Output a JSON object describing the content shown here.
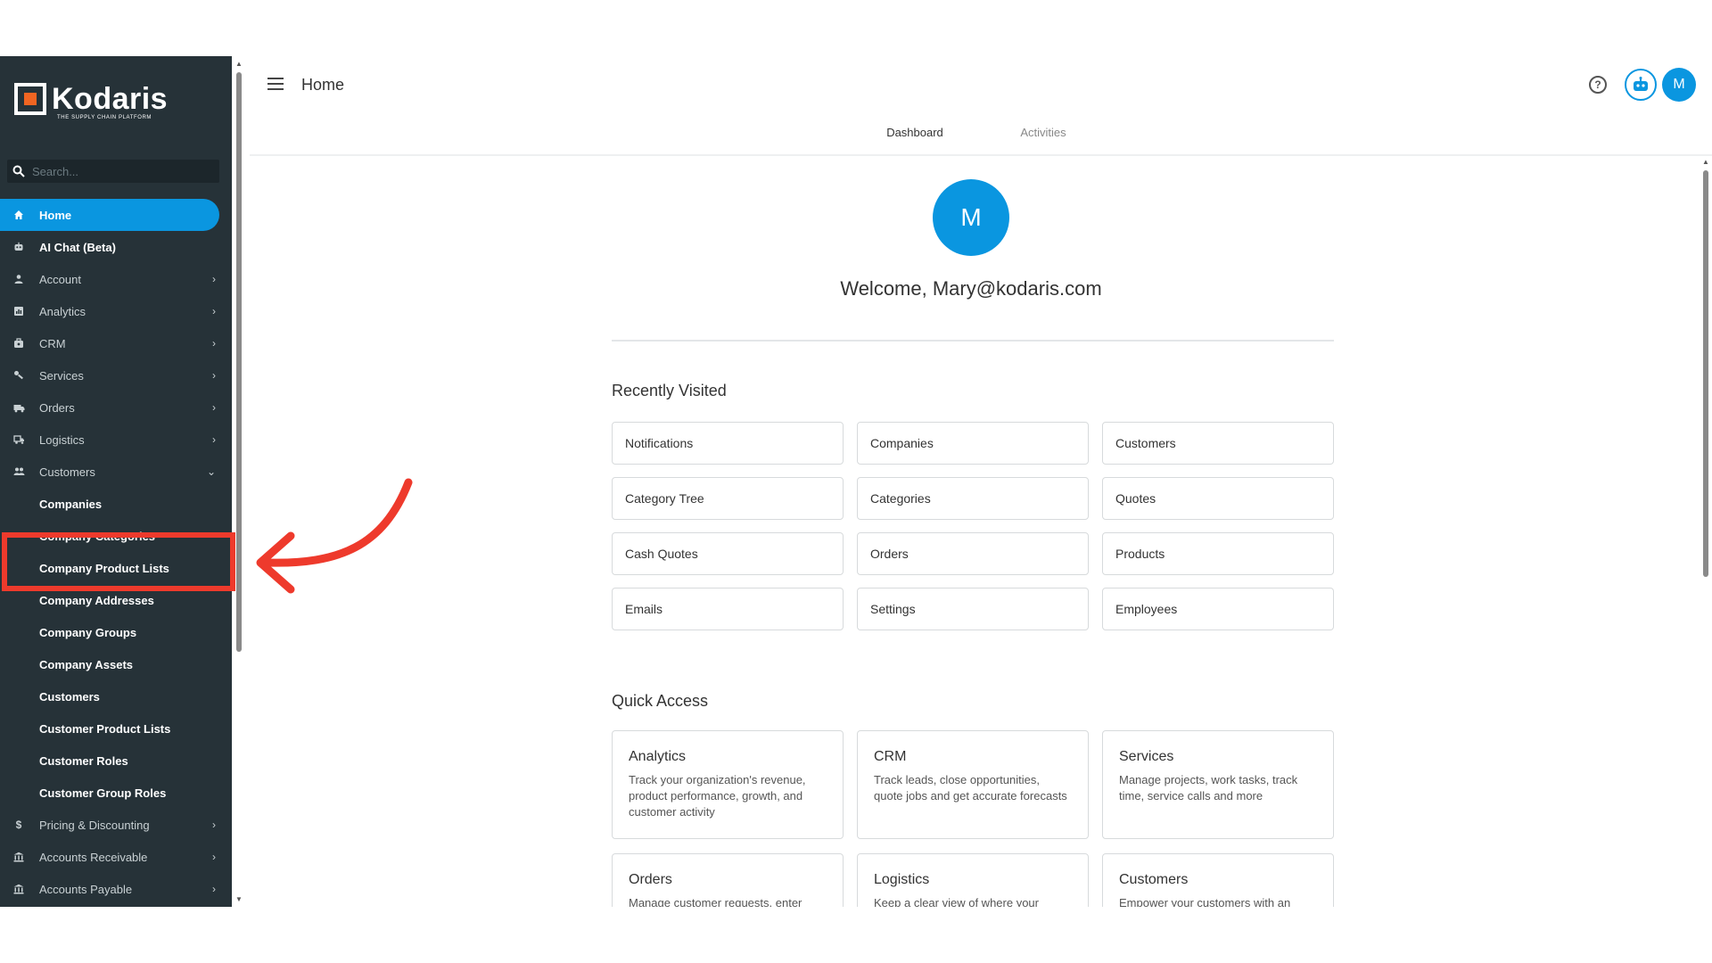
{
  "brand": {
    "name": "Kodaris",
    "tagline": "THE SUPPLY CHAIN PLATFORM"
  },
  "search": {
    "placeholder": "Search..."
  },
  "nav": [
    {
      "label": "Home",
      "icon": "home-icon",
      "state": "active"
    },
    {
      "label": "AI Chat (Beta)",
      "icon": "bot-icon"
    },
    {
      "label": "Account",
      "icon": "user-icon",
      "chevron": "›"
    },
    {
      "label": "Analytics",
      "icon": "chart-icon",
      "chevron": "›"
    },
    {
      "label": "CRM",
      "icon": "briefcase-icon",
      "chevron": "›"
    },
    {
      "label": "Services",
      "icon": "wrench-icon",
      "chevron": "›"
    },
    {
      "label": "Orders",
      "icon": "truck-icon",
      "chevron": "›"
    },
    {
      "label": "Logistics",
      "icon": "shipping-icon",
      "chevron": "›"
    },
    {
      "label": "Customers",
      "icon": "users-icon",
      "chevron": "⌄"
    }
  ],
  "customers_sub": [
    "Companies",
    "Company Categories",
    "Company Product Lists",
    "Company Addresses",
    "Company Groups",
    "Company Assets",
    "Customers",
    "Customer Product Lists",
    "Customer Roles",
    "Customer Group Roles"
  ],
  "nav_bottom": [
    {
      "label": "Pricing & Discounting",
      "icon": "dollar-icon",
      "chevron": "›"
    },
    {
      "label": "Accounts Receivable",
      "icon": "bank-icon",
      "chevron": "›"
    },
    {
      "label": "Accounts Payable",
      "icon": "bank-icon",
      "chevron": "›"
    }
  ],
  "header": {
    "title": "Home",
    "help_glyph": "?",
    "avatar_initial": "M"
  },
  "tabs": [
    {
      "label": "Dashboard",
      "active": true
    },
    {
      "label": "Activities",
      "active": false
    }
  ],
  "dashboard": {
    "avatar_initial": "M",
    "welcome": "Welcome, Mary@kodaris.com",
    "recent_title": "Recently Visited",
    "recent": [
      "Notifications",
      "Companies",
      "Customers",
      "Category Tree",
      "Categories",
      "Quotes",
      "Cash Quotes",
      "Orders",
      "Products",
      "Emails",
      "Settings",
      "Employees"
    ],
    "quick_title": "Quick Access",
    "quick": [
      {
        "title": "Analytics",
        "desc": "Track your organization's revenue, product performance, growth, and customer activity"
      },
      {
        "title": "CRM",
        "desc": "Track leads, close opportunities, quote jobs and get accurate forecasts"
      },
      {
        "title": "Services",
        "desc": "Manage projects, work tasks, track time, service calls and more"
      },
      {
        "title": "Orders",
        "desc": "Manage customer requests, enter"
      },
      {
        "title": "Logistics",
        "desc": "Keep a clear view of where your"
      },
      {
        "title": "Customers",
        "desc": "Empower your customers with an"
      }
    ]
  },
  "colors": {
    "accent": "#0a96e0",
    "sidebar": "#263238",
    "annotation": "#ee3a2c"
  }
}
